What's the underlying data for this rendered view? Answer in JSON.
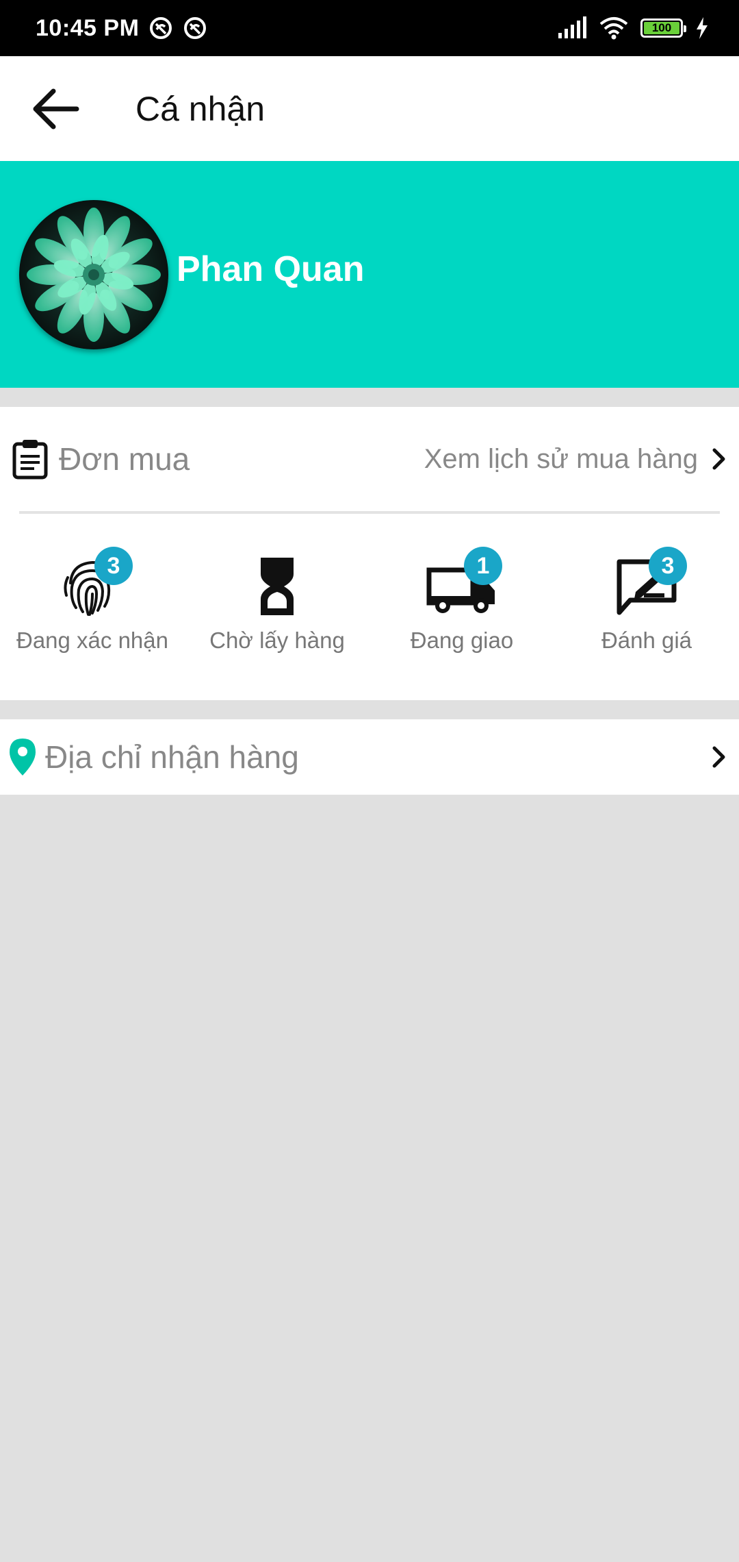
{
  "status_bar": {
    "time": "10:45 PM",
    "battery": "100",
    "icons": [
      "notification-icon",
      "notification-icon",
      "signal-icon",
      "wifi-icon",
      "battery-icon",
      "charging-icon"
    ]
  },
  "app_bar": {
    "title": "Cá nhận",
    "back_icon": "arrow-left-icon"
  },
  "profile": {
    "name": "Phan Quan",
    "banner_color": "#00d7c2"
  },
  "orders": {
    "title": "Đơn mua",
    "history_link": "Xem lịch sử mua hàng",
    "statuses": [
      {
        "label": "Đang xác nhận",
        "badge": "3",
        "icon": "fingerprint-icon"
      },
      {
        "label": "Chờ lấy hàng",
        "badge": "",
        "icon": "hourglass-icon"
      },
      {
        "label": "Đang giao",
        "badge": "1",
        "icon": "truck-icon"
      },
      {
        "label": "Đánh giá",
        "badge": "3",
        "icon": "review-icon"
      }
    ],
    "badge_color": "#1aa6c8"
  },
  "address": {
    "label": "Địa chỉ nhận hàng",
    "icon_color": "#00c4a7"
  }
}
